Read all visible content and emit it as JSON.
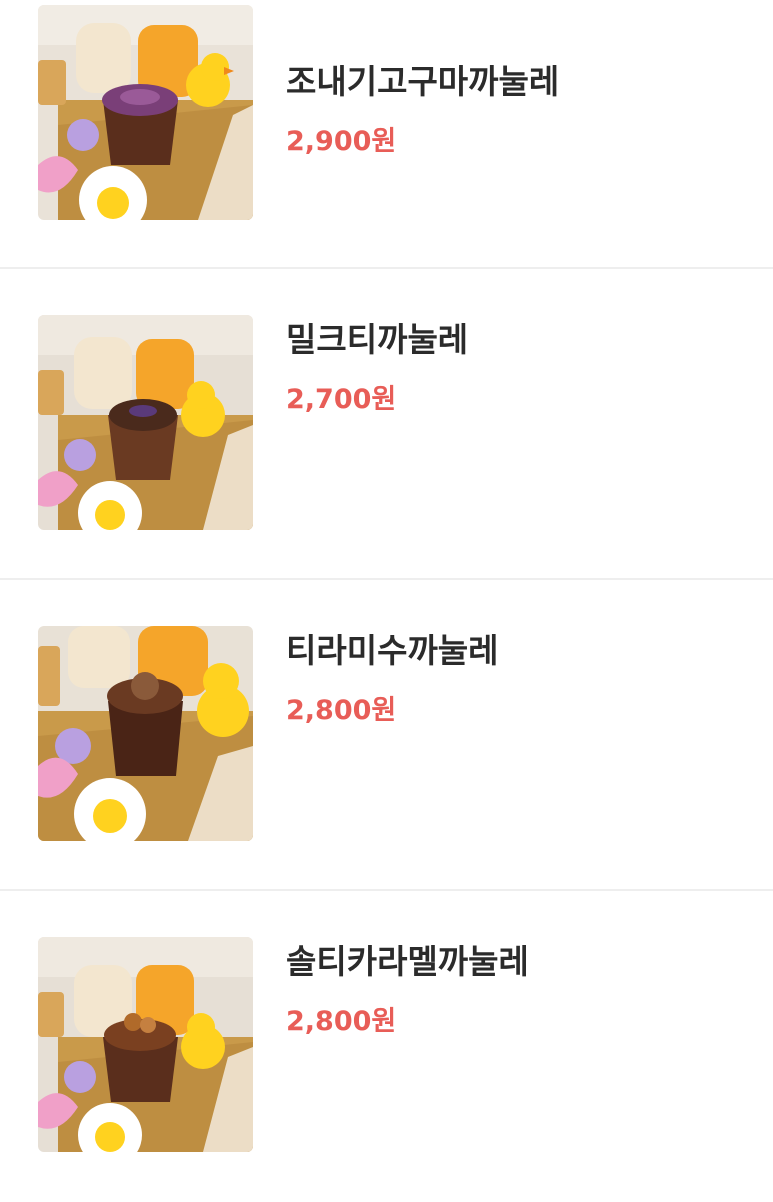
{
  "menu": {
    "items": [
      {
        "name": "조내기고구마까눌레",
        "price": "2,900원",
        "topping_color": "#7a3f78",
        "image_icon": "sweet-potato-canele-photo"
      },
      {
        "name": "밀크티까눌레",
        "price": "2,700원",
        "topping_color": "#4a2a1c",
        "image_icon": "milk-tea-canele-photo"
      },
      {
        "name": "티라미수까눌레",
        "price": "2,800원",
        "topping_color": "#8a5a3a",
        "image_icon": "tiramisu-canele-photo"
      },
      {
        "name": "솔티카라멜까눌레",
        "price": "2,800원",
        "topping_color": "#b06a2a",
        "image_icon": "salted-caramel-canele-photo"
      }
    ]
  },
  "colors": {
    "price": "#e85d57",
    "name": "#2b2b2b",
    "divider": "#eeeeee"
  }
}
